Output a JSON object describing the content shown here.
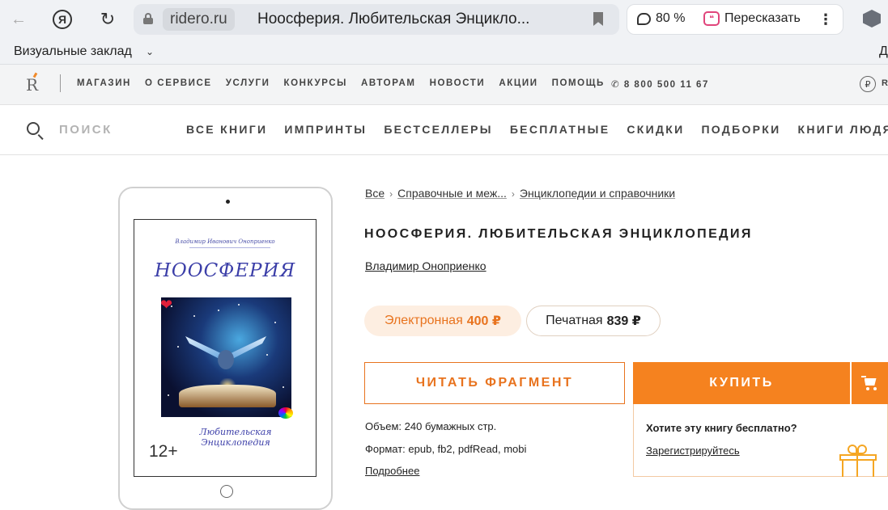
{
  "browser": {
    "domain": "ridero.ru",
    "tab_title": "Ноосферия. Любительская Энцикло...",
    "zoom": "80 %",
    "retell_label": "Пересказать",
    "ya_label": "Я",
    "bookmarks_item": "Визуальные заклад",
    "bookmarks_right": "Д"
  },
  "site_top": {
    "logo": "R",
    "nav": [
      "МАГАЗИН",
      "О СЕРВИСЕ",
      "УСЛУГИ",
      "КОНКУРСЫ",
      "АВТОРАМ",
      "НОВОСТИ",
      "АКЦИИ",
      "ПОМОЩЬ"
    ],
    "phone": "8 800 500 11 67",
    "ruble_symbol": "₽",
    "ruble_letter": "R"
  },
  "main_nav": {
    "search_placeholder": "ПОИСК",
    "items": [
      "ВСЕ КНИГИ",
      "ИМПРИНТЫ",
      "БЕСТСЕЛЛЕРЫ",
      "БЕСПЛАТНЫЕ",
      "СКИДКИ",
      "ПОДБОРКИ",
      "КНИГИ ЛЮДЯМ"
    ]
  },
  "cover": {
    "author": "Владимир Иванович Оноприенко",
    "title": "НООСФЕРИЯ",
    "subtitle": "Любительская Энциклопедия",
    "age": "12+"
  },
  "product": {
    "breadcrumbs": [
      "Все",
      "Справочные и меж...",
      "Энциклопедии и справочники"
    ],
    "title": "НООСФЕРИЯ. ЛЮБИТЕЛЬСКАЯ ЭНЦИКЛОПЕДИЯ",
    "author": "Владимир Оноприенко",
    "price_electronic_label": "Электронная",
    "price_electronic_value": "400 ₽",
    "price_print_label": "Печатная",
    "price_print_value": "839 ₽",
    "read_button": "ЧИТАТЬ ФРАГМЕНТ",
    "buy_button": "КУПИТЬ",
    "volume": "Объем: 240 бумажных стр.",
    "format": "Формат: epub, fb2, pdfRead, mobi",
    "more_link": "Подробнее",
    "promo_question": "Хотите эту книгу бесплатно?",
    "promo_link": "Зарегистрируйтесь"
  },
  "colors": {
    "accent": "#f5821f",
    "accent_light": "#fdeee1"
  }
}
